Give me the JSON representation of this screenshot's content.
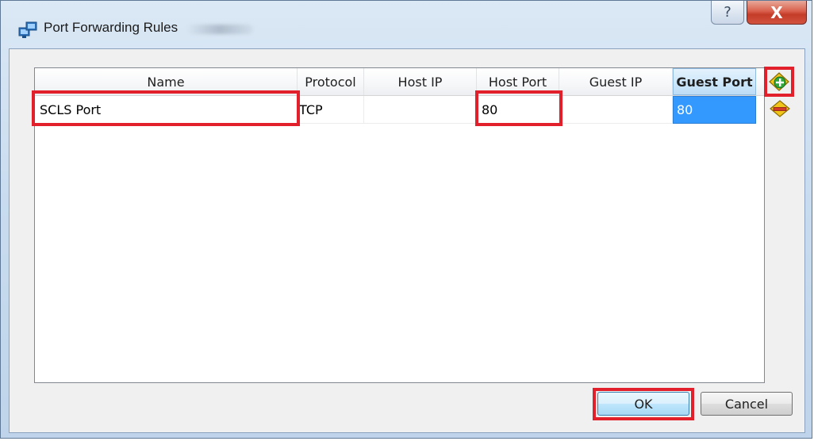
{
  "window": {
    "title": "Port Forwarding Rules",
    "help_glyph": "?",
    "close_glyph": "X"
  },
  "table": {
    "columns": [
      "Name",
      "Protocol",
      "Host IP",
      "Host Port",
      "Guest IP",
      "Guest Port"
    ],
    "sorted_column": "Guest Port",
    "rows": [
      {
        "name": "SCLS Port",
        "protocol": "TCP",
        "host_ip": "",
        "host_port": "80",
        "guest_ip": "",
        "guest_port": "80"
      }
    ]
  },
  "tools": {
    "add_icon": "add-rule-icon",
    "remove_icon": "remove-rule-icon"
  },
  "buttons": {
    "ok": "OK",
    "cancel": "Cancel"
  },
  "colors": {
    "highlight": "#e2202c",
    "selection": "#3399ff"
  }
}
